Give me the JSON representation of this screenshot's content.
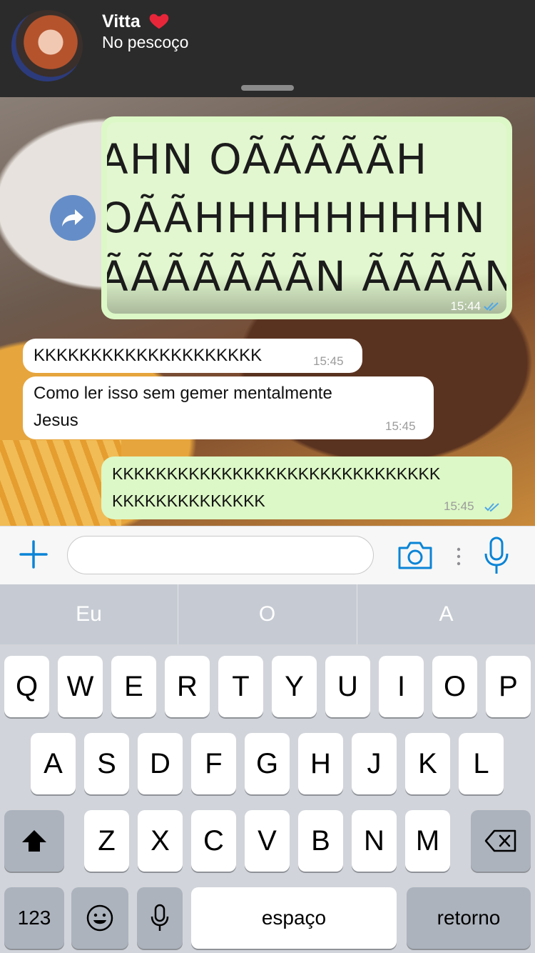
{
  "notification": {
    "sender_name": "Vitta",
    "heart_icon": "red-heart",
    "message_preview": "No pescoço"
  },
  "chat": {
    "image_message": {
      "image_text_lines": [
        "AHN OÃÃÃÃÃH",
        "OÃÃHHHHHHHHN",
        "ÃÃÃÃÃÃÃN ÃÃÃÃN"
      ],
      "time": "15:44",
      "status": "read"
    },
    "messages": [
      {
        "direction": "in",
        "text": "KKKKKKKKKKKKKKKKKKKK",
        "time": "15:45"
      },
      {
        "direction": "in",
        "text_lines": [
          "Como ler isso sem gemer mentalmente",
          "Jesus"
        ],
        "time": "15:45"
      },
      {
        "direction": "out",
        "text_lines": [
          "KKKKKKKKKKKKKKKKKKKKKKKKKKKKKK",
          "KKKKKKKKKKKKKK"
        ],
        "time": "15:45",
        "status": "read"
      }
    ]
  },
  "input": {
    "placeholder": "",
    "icons": [
      "plus-icon",
      "camera-icon",
      "more-dots-icon",
      "microphone-icon"
    ]
  },
  "keyboard": {
    "suggestions": [
      "Eu",
      "O",
      "A"
    ],
    "row1": [
      "Q",
      "W",
      "E",
      "R",
      "T",
      "Y",
      "U",
      "I",
      "O",
      "P"
    ],
    "row2": [
      "A",
      "S",
      "D",
      "F",
      "G",
      "H",
      "J",
      "K",
      "L"
    ],
    "row3": [
      "Z",
      "X",
      "C",
      "V",
      "B",
      "N",
      "M"
    ],
    "numbers_label": "123",
    "space_label": "espaço",
    "return_label": "retorno"
  },
  "colors": {
    "outgoing_bubble": "#dcf8c6",
    "incoming_bubble": "#ffffff",
    "accent_blue": "#0a84d6",
    "read_ticks": "#4fa7e8"
  }
}
